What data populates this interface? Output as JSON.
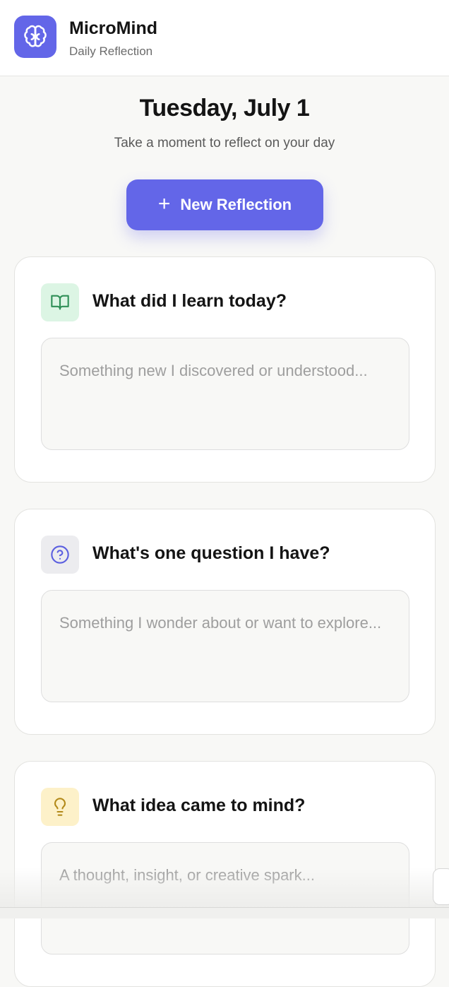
{
  "app": {
    "name": "MicroMind",
    "subtitle": "Daily Reflection",
    "logo_icon": "brain-icon",
    "accent_color": "#6366e8"
  },
  "hero": {
    "date": "Tuesday, July 1",
    "tagline": "Take a moment to reflect on your day",
    "new_button_label": "New Reflection",
    "new_button_icon": "plus-icon"
  },
  "cards": [
    {
      "title": "What did I learn today?",
      "icon": "book-icon",
      "icon_bg": "#dcf5e4",
      "icon_color": "#2f8f57",
      "placeholder": "Something new I discovered or understood...",
      "value": ""
    },
    {
      "title": "What's one question I have?",
      "icon": "question-circle-icon",
      "icon_bg": "#ececef",
      "icon_color": "#5b5fe0",
      "placeholder": "Something I wonder about or want to explore...",
      "value": ""
    },
    {
      "title": "What idea came to mind?",
      "icon": "lightbulb-icon",
      "icon_bg": "#fdf1c9",
      "icon_color": "#b38a1a",
      "placeholder": "A thought, insight, or creative spark...",
      "value": ""
    }
  ]
}
